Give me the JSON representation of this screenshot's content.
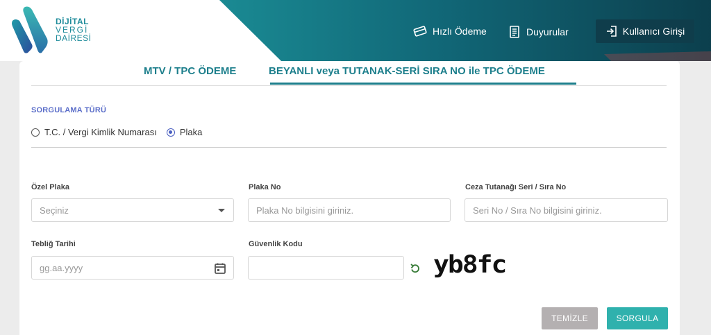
{
  "brand": {
    "logo_line1": "DİJİTAL",
    "logo_line2": "VERGİ",
    "logo_line3": "DAİRESİ"
  },
  "nav": {
    "quick_pay": "Hızlı Ödeme",
    "announcements": "Duyurular",
    "login": "Kullanıcı Girişi"
  },
  "tabs": [
    {
      "label": "MTV / TPC ÖDEME",
      "active": false
    },
    {
      "label": "BEYANLI veya TUTANAK-SERİ SIRA NO ile TPC ÖDEME",
      "active": true
    }
  ],
  "query": {
    "section_label": "SORGULAMA TÜRÜ",
    "options": [
      {
        "label": "T.C. / Vergi Kimlik Numarası",
        "selected": false
      },
      {
        "label": "Plaka",
        "selected": true
      }
    ]
  },
  "fields": {
    "special_plate": {
      "label": "Özel Plaka",
      "value": "Seçiniz"
    },
    "plate_no": {
      "label": "Plaka No",
      "placeholder": "Plaka No bilgisini giriniz."
    },
    "ticket_serial": {
      "label": "Ceza Tutanağı Seri / Sıra No",
      "placeholder": "Seri No / Sıra No bilgisini giriniz."
    },
    "notice_date": {
      "label": "Tebliğ Tarihi",
      "placeholder": "gg.aa.yyyy"
    },
    "security_code": {
      "label": "Güvenlik Kodu",
      "value": ""
    }
  },
  "captcha": {
    "text": "yb8fc"
  },
  "buttons": {
    "clear": "TEMİZLE",
    "submit": "SORGULA"
  },
  "colors": {
    "accent": "#1d7f8c",
    "header_dark": "#0f3d4b",
    "submit": "#2fb1ad",
    "clear": "#b4b0b1",
    "radio": "#4a5fc1"
  }
}
